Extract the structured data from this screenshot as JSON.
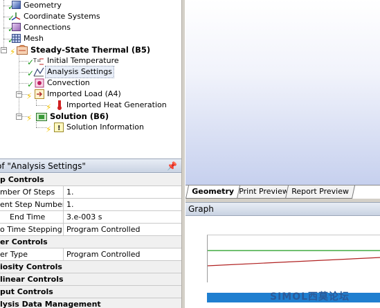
{
  "tree": {
    "items": [
      {
        "label": "Geometry"
      },
      {
        "label": "Coordinate Systems"
      },
      {
        "label": "Connections"
      },
      {
        "label": "Mesh"
      },
      {
        "label": "Steady-State Thermal (B5)"
      },
      {
        "label": "Initial Temperature"
      },
      {
        "label": "Analysis Settings"
      },
      {
        "label": "Convection"
      },
      {
        "label": "Imported Load (A4)"
      },
      {
        "label": "Imported Heat Generation"
      },
      {
        "label": "Solution (B6)"
      },
      {
        "label": "Solution Information"
      }
    ]
  },
  "details": {
    "title": "of \"Analysis Settings\"",
    "rows": [
      {
        "c1": "p Controls",
        "cat": true
      },
      {
        "c1": "mber Of Steps",
        "c2": "1."
      },
      {
        "c1": "ent Step Number",
        "c2": "1."
      },
      {
        "c1": "End Time",
        "c2": "3.e-003 s"
      },
      {
        "c1": "o Time Stepping",
        "c2": "Program Controlled"
      },
      {
        "c1": "er Controls",
        "cat": true
      },
      {
        "c1": "er Type",
        "c2": "Program Controlled"
      },
      {
        "c1": "iosity Controls",
        "cat": true
      },
      {
        "c1": "linear Controls",
        "cat": true
      },
      {
        "c1": "put Controls",
        "cat": true
      },
      {
        "c1": "lysis Data Management",
        "cat": true
      }
    ]
  },
  "tabs": {
    "geometry": "Geometry",
    "print_preview": "Print Preview",
    "report_preview": "Report Preview"
  },
  "graph": {
    "title": "Graph"
  },
  "watermark": "SIMOL西莫论坛",
  "colors": {
    "accent_blue": "#1f7fd0",
    "graph_green": "#1a9a1a",
    "graph_red": "#b02020",
    "check_green": "#1b9a1b"
  }
}
